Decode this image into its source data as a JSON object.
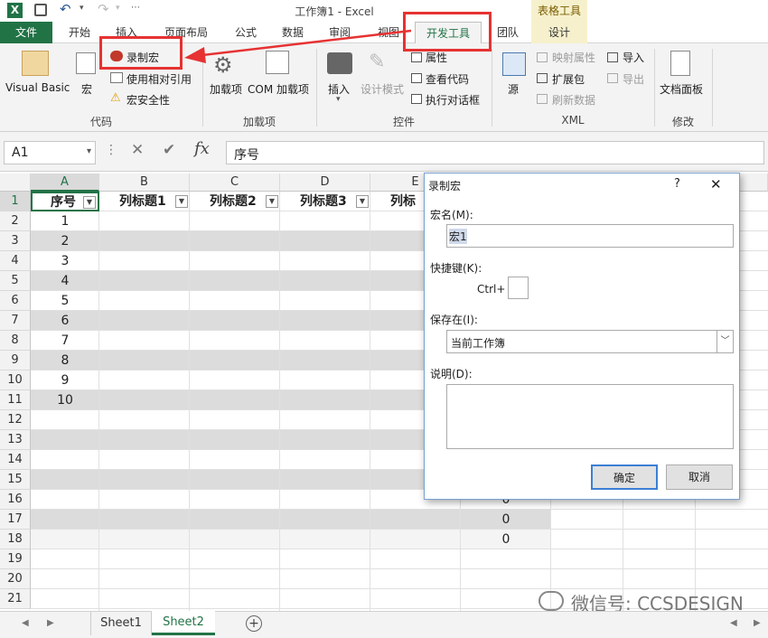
{
  "app": {
    "icon_letter": "X",
    "title": "工作簿1 - Excel",
    "table_tools_label": "表格工具"
  },
  "tabs": [
    "文件",
    "开始",
    "插入",
    "页面布局",
    "公式",
    "数据",
    "审阅",
    "视图",
    "开发工具",
    "团队",
    "设计"
  ],
  "ribbon": {
    "code": {
      "visual_basic": "Visual Basic",
      "macros": "宏",
      "record_macro": "录制宏",
      "relative_ref": "使用相对引用",
      "macro_security": "宏安全性",
      "group": "代码"
    },
    "addins": {
      "addins": "加载项",
      "com_addins": "COM 加载项",
      "group": "加载项"
    },
    "controls": {
      "insert": "插入",
      "design_mode": "设计模式",
      "properties": "属性",
      "view_code": "查看代码",
      "run_dialog": "执行对话框",
      "group": "控件"
    },
    "xml": {
      "source": "源",
      "map_props": "映射属性",
      "expansion": "扩展包",
      "refresh": "刷新数据",
      "import": "导入",
      "export": "导出",
      "group": "XML"
    },
    "modify": {
      "doc_panel": "文档面板",
      "group": "修改"
    }
  },
  "formula_bar": {
    "name_box": "A1",
    "fx": "fx",
    "value": "序号"
  },
  "columns": [
    "A",
    "B",
    "C",
    "D",
    "E"
  ],
  "headers": [
    "序号",
    "列标题1",
    "列标题2",
    "列标题3",
    "列标"
  ],
  "rows": [
    "1",
    "2",
    "3",
    "4",
    "5",
    "6",
    "7",
    "8",
    "9",
    "10",
    "11",
    "12",
    "13",
    "14",
    "15",
    "16",
    "17",
    "18",
    "19",
    "20",
    "21"
  ],
  "a_values": [
    "1",
    "2",
    "3",
    "4",
    "5",
    "6",
    "7",
    "8",
    "9",
    "10"
  ],
  "zero_values": [
    "0",
    "0",
    "0"
  ],
  "dialog": {
    "title": "录制宏",
    "help": "?",
    "close": "✕",
    "name_label": "宏名(M):",
    "name_value": "宏1",
    "shortcut_label": "快捷键(K):",
    "ctrl_label": "Ctrl+",
    "store_label": "保存在(I):",
    "store_value": "当前工作簿",
    "desc_label": "说明(D):",
    "ok": "确定",
    "cancel": "取消"
  },
  "sheets": {
    "sheet1": "Sheet1",
    "sheet2": "Sheet2",
    "active": "Sheet2"
  },
  "watermark": "微信号: CCSDESIGN",
  "colors": {
    "excel_green": "#217346",
    "highlight_red": "#e63232",
    "table_tools_bg": "#f6f1cc"
  }
}
